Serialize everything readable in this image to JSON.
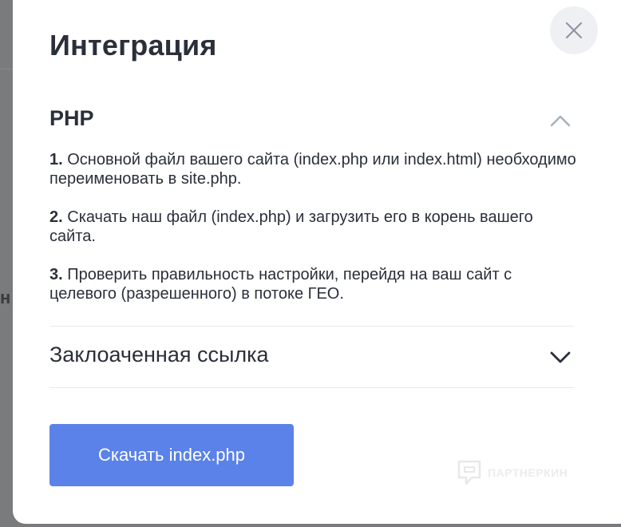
{
  "background": {
    "partial_text": "н"
  },
  "modal": {
    "title": "Интеграция",
    "close_icon": "close-icon"
  },
  "php_section": {
    "title": "PHP",
    "expanded": true,
    "steps": [
      {
        "num": "1.",
        "text": " Основной файл вашего сайта (index.php или index.html) необходимо переименовать в site.php."
      },
      {
        "num": "2.",
        "text": " Скачать наш файл (index.php) и загрузить его в корень вашего сайта."
      },
      {
        "num": "3.",
        "text": " Проверить правильность настройки, перейдя на ваш сайт с целевого (разрешенного) в потоке ГЕО."
      }
    ]
  },
  "cloaked_section": {
    "title": "Заклоаченная ссылка",
    "expanded": false
  },
  "download_button": {
    "label": "Скачать index.php"
  },
  "watermark": {
    "text": "ПАРТНЕРКИН"
  },
  "colors": {
    "accent": "#5a82e8",
    "text": "#2a2f3a",
    "close_bg": "#eef0f3"
  }
}
